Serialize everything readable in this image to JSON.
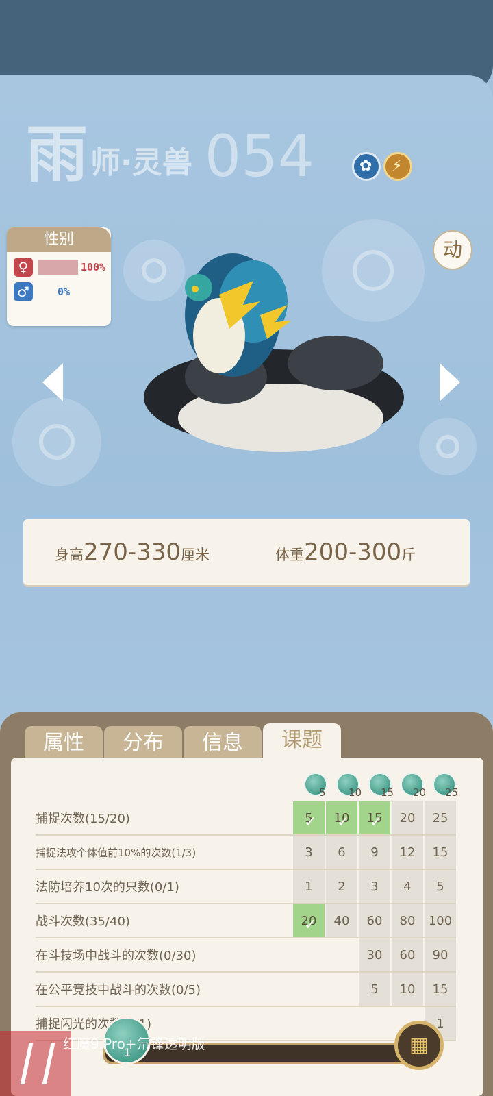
{
  "header": {
    "title_big": "雨",
    "title_rest": "师·灵兽",
    "number": "054",
    "elements": [
      "wind-icon",
      "thunder-icon"
    ]
  },
  "gender": {
    "label": "性别",
    "female_pct": "100%",
    "male_pct": "0%",
    "female_ratio": 1.0
  },
  "motion_button": "动",
  "size": {
    "height_label": "身高",
    "height_value": "270-330",
    "height_unit": "厘米",
    "weight_label": "体重",
    "weight_value": "200-300",
    "weight_unit": "斤"
  },
  "tabs": [
    "属性",
    "分布",
    "信息",
    "课题"
  ],
  "active_tab": "课题",
  "milestones": [
    "5",
    "10",
    "15",
    "20",
    "25"
  ],
  "tasks": [
    {
      "name": "捕捉次数(15/20)",
      "cells": [
        "5",
        "10",
        "15",
        "20",
        "25"
      ],
      "done": [
        true,
        true,
        true,
        false,
        false
      ]
    },
    {
      "name": "捕捉法攻个体值前10%的次数(1/3)",
      "cells": [
        "3",
        "6",
        "9",
        "12",
        "15"
      ],
      "done": [
        false,
        false,
        false,
        false,
        false
      ]
    },
    {
      "name": "法防培养10次的只数(0/1)",
      "cells": [
        "1",
        "2",
        "3",
        "4",
        "5"
      ],
      "done": [
        false,
        false,
        false,
        false,
        false
      ]
    },
    {
      "name": "战斗次数(35/40)",
      "cells": [
        "20",
        "40",
        "60",
        "80",
        "100"
      ],
      "done": [
        true,
        false,
        false,
        false,
        false
      ]
    },
    {
      "name": "在斗技场中战斗的次数(0/30)",
      "cells": [
        "",
        "",
        "30",
        "60",
        "90"
      ],
      "done": [
        false,
        false,
        false,
        false,
        false
      ]
    },
    {
      "name": "在公平竞技中战斗的次数(0/5)",
      "cells": [
        "",
        "",
        "5",
        "10",
        "15"
      ],
      "done": [
        false,
        false,
        false,
        false,
        false
      ]
    },
    {
      "name": "捕捉闪光的次数(0/1)",
      "cells": [
        "",
        "",
        "",
        "",
        "1"
      ],
      "done": [
        false,
        false,
        false,
        false,
        false
      ]
    }
  ],
  "bottom": {
    "orb_label": "1"
  },
  "watermark": "红魔9 Pro+氘锋透明版"
}
